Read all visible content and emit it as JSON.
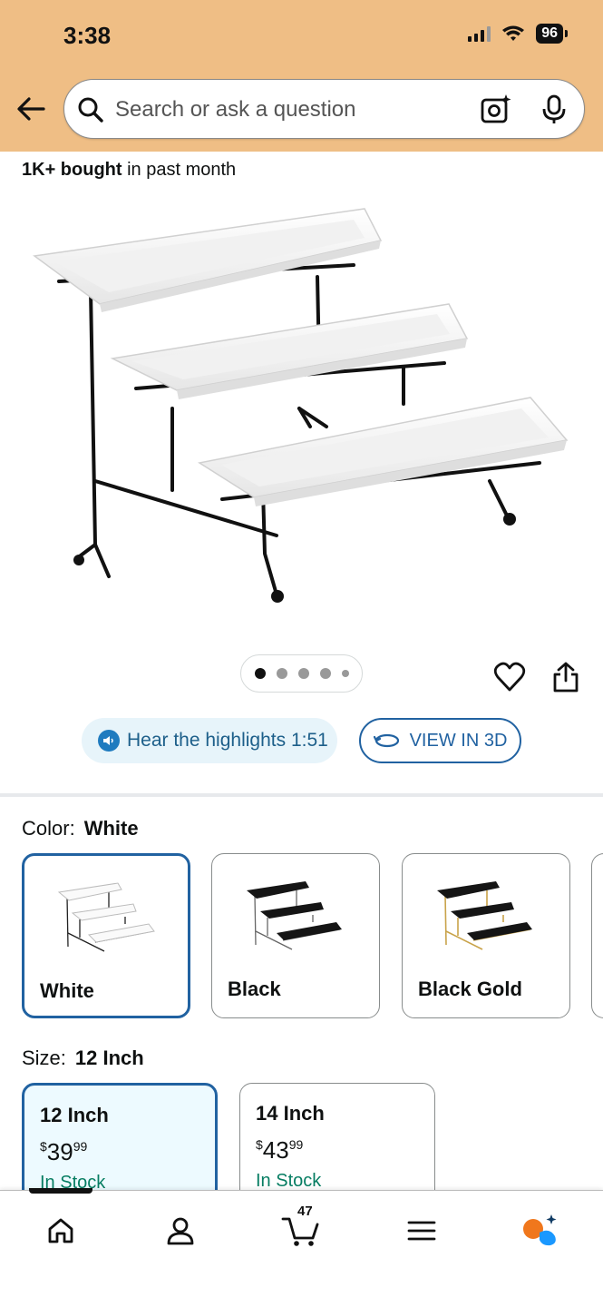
{
  "status_bar": {
    "time": "3:38",
    "battery": "96"
  },
  "search": {
    "placeholder": "Search or ask a question"
  },
  "bought": {
    "strong": "1K+ bought",
    "rest": "in past month"
  },
  "carousel": {
    "total": 5,
    "active_index": 0
  },
  "highlights": {
    "label": "Hear the highlights 1:51"
  },
  "view3d": {
    "label": "VIEW IN 3D"
  },
  "color": {
    "label": "Color:",
    "selected": "White",
    "options": [
      "White",
      "Black",
      "Black Gold"
    ]
  },
  "size": {
    "label": "Size:",
    "selected": "12 Inch",
    "options": [
      {
        "name": "12 Inch",
        "currency": "$",
        "whole": "39",
        "fraction": "99",
        "stock": "In Stock"
      },
      {
        "name": "14 Inch",
        "currency": "$",
        "whole": "43",
        "fraction": "99",
        "stock": "In Stock"
      }
    ]
  },
  "nav": {
    "cart_count": "47"
  },
  "colors": {
    "header_bg": "#efbe85",
    "accent_blue": "#2162a1",
    "stock_green": "#067d62"
  }
}
